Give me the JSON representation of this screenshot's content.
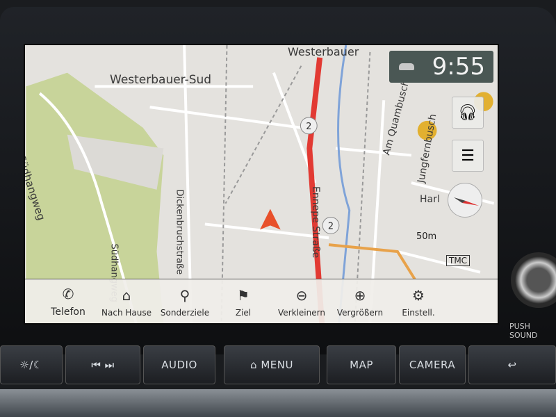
{
  "clock": "9:55",
  "map": {
    "labels": {
      "area1": "Westerbauer-Sud",
      "area2": "Westerbauer",
      "street1": "Südhangweg",
      "street2": "Dickenbruchstraße",
      "street3": "Ennepe Straße",
      "street4": "Am Quambusch",
      "street5": "Jungfernbusch",
      "street6": "Harl",
      "street7": "Südhangweg"
    },
    "route_badge": "2",
    "scale": "50m",
    "tmc": "TMC",
    "colors": {
      "route": "#e23a33",
      "land": "#e4e2de",
      "forest": "#c8d49a",
      "river": "#7fa3d8"
    }
  },
  "toolbar": [
    {
      "label": "Telefon",
      "icon": "phone-icon"
    },
    {
      "label": "Nach Hause",
      "icon": "home-icon"
    },
    {
      "label": "Sonderziele",
      "icon": "poi-pin-icon"
    },
    {
      "label": "Ziel",
      "icon": "checkered-flag-icon"
    },
    {
      "label": "Verkleinern",
      "icon": "zoom-out-icon"
    },
    {
      "label": "Vergrößern",
      "icon": "zoom-in-icon"
    },
    {
      "label": "Einstell.",
      "icon": "gear-icon"
    }
  ],
  "hardware": {
    "audio": "AUDIO",
    "menu": "MENU",
    "map": "MAP",
    "camera": "CAMERA",
    "push": "PUSH SOUND"
  }
}
